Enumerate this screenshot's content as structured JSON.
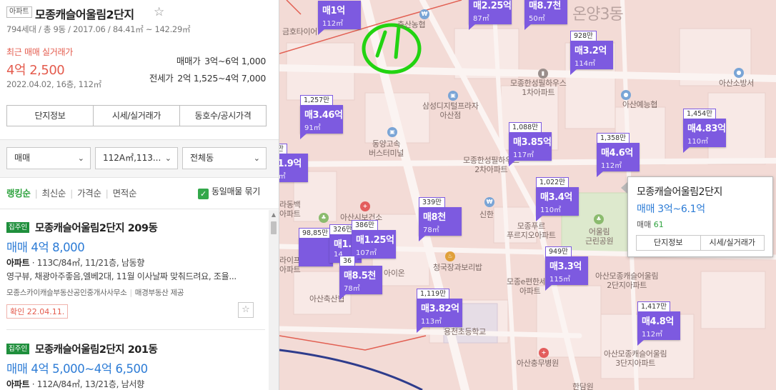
{
  "complex": {
    "type_badge": "아파트",
    "name": "모종캐슬어울림2단지",
    "meta": "794세대 / 총 9동 / 2017.06 / 84.41㎡ ~ 142.29㎡"
  },
  "recent_trade": {
    "label": "최근 매매 실거래가",
    "price": "4억 2,500",
    "detail": "2022.04.02, 16층, 112㎡"
  },
  "ranges": {
    "sale_label": "매매가",
    "sale_value": "3억~6억 1,000",
    "jeonse_label": "전세가",
    "jeonse_value": "2억 1,525~4억 7,000"
  },
  "tab_buttons": [
    "단지정보",
    "시세/실거래가",
    "동호수/공시가격"
  ],
  "filters": {
    "trade_type": "매매",
    "area": "112A㎡,113...",
    "dong": "전체동"
  },
  "sort": {
    "options": [
      "랭킹순",
      "최신순",
      "가격순",
      "면적순"
    ],
    "merge_label": "동일매물 묶기"
  },
  "listings": [
    {
      "badge": "집주인",
      "title": "모종캐슬어울림2단지 209동",
      "price": "매매 4억 8,000",
      "spec_type": "아파트",
      "spec": "· 113C/84㎡, 11/21층, 남동향",
      "desc": "영구뷰, 채광아주좋음,엘베2대, 11월 이사날짜 맞춰드려요, 조율...",
      "agent": "모종스카이캐슬부동산공인중개사사무소",
      "provider": "매경부동산 제공",
      "confirmed": "확인 22.04.11."
    },
    {
      "badge": "집주인",
      "title": "모종캐슬어울림2단지 201동",
      "price": "매매 4억 5,000~4억 6,500",
      "spec_type": "아파트",
      "spec": "· 112A/84㎡, 13/21층, 남서향"
    }
  ],
  "map": {
    "dong_label": "온양3동",
    "labels": {
      "geumho_tire": "금호타이어",
      "nonghyup": "축산농협",
      "onyang_tech": "동양고속\n버스터미널",
      "samsung_digital": "삼성디지털프라자\n아산점",
      "hanseong1": "모종한성필하우스\n1차아파트",
      "hanseong2": "모종한성필하우스\n2차아파트",
      "asan_nursery": "아산예능협",
      "asan_fire": "아산소방서",
      "asan_city": "아산시보건소",
      "shinhan": "신한",
      "prugio": "모종푸르\n푸르지오아파트",
      "eoulim_park": "어울림\n근린공원",
      "jangteo": "청국장과보리밥",
      "eoulim2": "아산모종캐슬어울림\n2단지아파트",
      "eoulim3": "아산모종캐슬어울림\n3단지아파트",
      "epyeonhan": "모종e편한세상\n아파트",
      "school": "용천초등학교",
      "hospital": "아산충무병원",
      "jin": "한담원",
      "baekhwa": "라동백\n아파트",
      "prime": "라이프타운\n아파트",
      "asan_suksan": "아산축산협",
      "aion": "아이온"
    },
    "markers": [
      {
        "pp": "",
        "price": "매1억",
        "area": "112㎡"
      },
      {
        "pp": "",
        "price": "매2.25억",
        "area": "87㎡"
      },
      {
        "pp": "",
        "price": "매8.7천",
        "area": "50㎡"
      },
      {
        "pp": "928만",
        "price": "매3.2억",
        "area": "114㎡"
      },
      {
        "pp": "1,257만",
        "price": "매3.46억",
        "area": "91㎡"
      },
      {
        "pp": "1,088만",
        "price": "매3.85억",
        "area": "117㎡"
      },
      {
        "pp": "1,358만",
        "price": "매4.6억",
        "area": "112㎡"
      },
      {
        "pp": "1,454만",
        "price": "매4.83억",
        "area": "110㎡"
      },
      {
        "pp": "22만",
        "price": "매1.9억",
        "area": "01㎡"
      },
      {
        "pp": "1,022만",
        "price": "매3.4억",
        "area": "110㎡"
      },
      {
        "pp": "339만",
        "price": "매8천",
        "area": "78㎡"
      },
      {
        "pp": "98,85만",
        "price": "",
        "area": ""
      },
      {
        "pp": "326만",
        "price": "매1.",
        "area": "14"
      },
      {
        "pp": "386만",
        "price": "매1.25억",
        "area": "107㎡"
      },
      {
        "pp": "36",
        "price": "매8.5천",
        "area": "78㎡"
      },
      {
        "pp": "949만",
        "price": "매3.3억",
        "area": "115㎡"
      },
      {
        "pp": "1,119만",
        "price": "매3.82억",
        "area": "113㎡"
      },
      {
        "pp": "1,417만",
        "price": "매4.8억",
        "area": "112㎡"
      }
    ],
    "popup": {
      "title": "모종캐슬어울림2단지",
      "price": "매매 3억~6.1억",
      "count_label": "매매",
      "count": "61",
      "btn_info": "단지정보",
      "btn_price": "시세/실거래가"
    }
  },
  "colors": {
    "accent_green": "#2fa33f",
    "price_red": "#e45b4d",
    "price_blue": "#2d7cd6",
    "marker_purple": "#7d5ae0",
    "annotation_green": "#22d311"
  }
}
